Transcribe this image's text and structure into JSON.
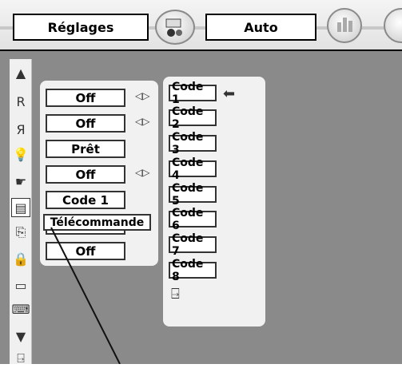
{
  "header": {
    "title": "Réglages",
    "mode_value": "Auto"
  },
  "settings_rows": [
    {
      "value": "Off",
      "has_arrows": true
    },
    {
      "value": "Off",
      "has_arrows": true
    },
    {
      "value": "Prêt",
      "has_arrows": false
    },
    {
      "value": "Off",
      "has_arrows": true
    },
    {
      "value": "Code 1",
      "has_arrows": false
    },
    {
      "value": "",
      "has_arrows": false
    },
    {
      "value": "Off",
      "has_arrows": false
    }
  ],
  "code_list": [
    "Code 1",
    "Code 2",
    "Code 3",
    "Code 4",
    "Code 5",
    "Code 6",
    "Code 7",
    "Code 8"
  ],
  "tooltip": "Télécommande",
  "sidebar_icons": [
    "up-arrow-icon",
    "logo-r-icon",
    "logo-r-mirror-icon",
    "lamp-icon",
    "hand-icon",
    "remote-control-icon",
    "usb-icon",
    "lock-icon",
    "battery-icon",
    "network-icon",
    "down-arrow-icon",
    "exit-icon"
  ],
  "colors": {
    "background": "#8a8a8a",
    "panel": "#f1f1f1",
    "box": "#ffffff",
    "border": "#333333"
  }
}
